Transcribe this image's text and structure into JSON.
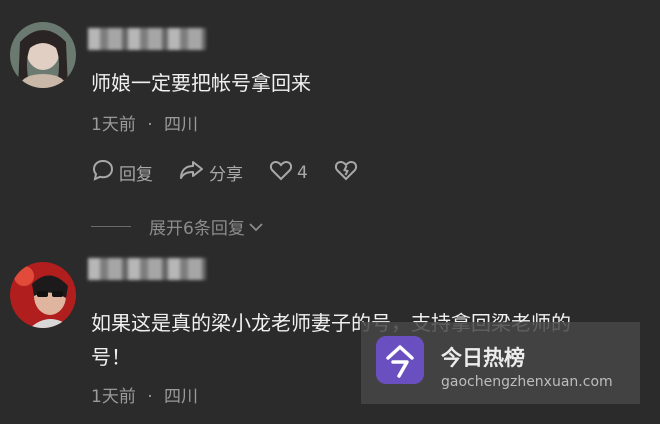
{
  "comments": [
    {
      "content": "师娘一定要把帐号拿回来",
      "time": "1天前",
      "separator": "·",
      "location": "四川",
      "reply_label": "回复",
      "share_label": "分享",
      "like_count": "4",
      "expand_label": "展开6条回复",
      "icons": [
        "reply-icon",
        "share-icon",
        "like-icon",
        "dislike-icon",
        "chevron-down-icon"
      ]
    },
    {
      "content_line1": "如果这是真的梁小龙老师妻子的号，支持拿回梁老师的",
      "content_line2": "号！",
      "time": "1天前",
      "separator": "·",
      "location": "四川"
    }
  ],
  "watermark": {
    "title": "今日热榜",
    "url": "gaochengzhenxuan.com",
    "logo_color": "#6a4fc1"
  }
}
